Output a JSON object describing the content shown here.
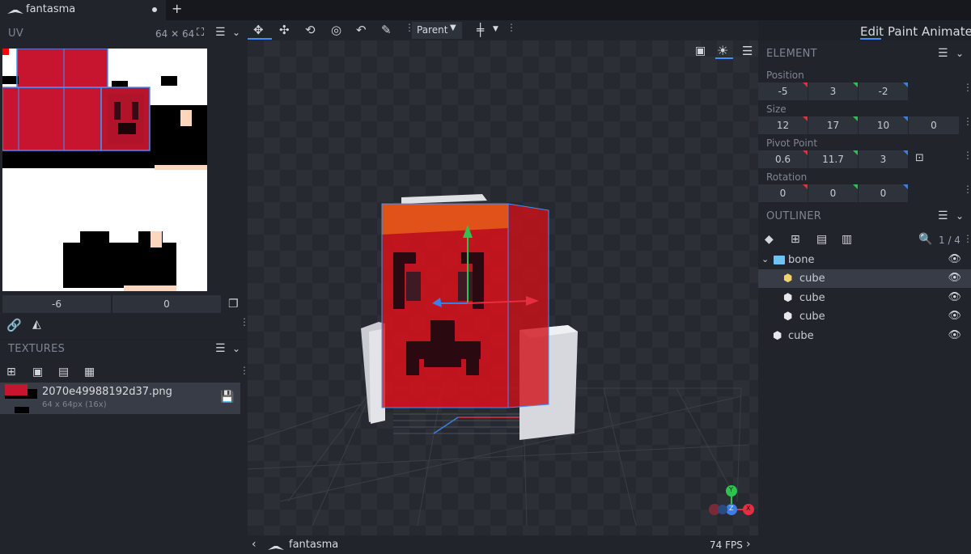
{
  "tab": {
    "title": "fantasma"
  },
  "uv": {
    "header": "UV",
    "size": "64 ✕ 64",
    "inputs": [
      "-6",
      "0"
    ]
  },
  "textures": {
    "header": "TEXTURES",
    "file_name": "2070e49988192d37.png",
    "file_info": "64 x 64px (16x)"
  },
  "toolbar": {
    "pivot_mode": "Parent",
    "modes": [
      "Edit",
      "Paint",
      "Animate"
    ],
    "active_mode": "Edit"
  },
  "element": {
    "header": "ELEMENT",
    "position": {
      "label": "Position",
      "values": [
        "-5",
        "3",
        "-2"
      ]
    },
    "size": {
      "label": "Size",
      "values": [
        "12",
        "17",
        "10",
        "0"
      ]
    },
    "pivot": {
      "label": "Pivot Point",
      "values": [
        "0.6",
        "11.7",
        "3"
      ]
    },
    "rotation": {
      "label": "Rotation",
      "values": [
        "0",
        "0",
        "0"
      ]
    }
  },
  "outliner": {
    "header": "OUTLINER",
    "count": "1 / 4",
    "items": [
      {
        "name": "bone",
        "type": "folder"
      },
      {
        "name": "cube",
        "type": "cube",
        "selected": true
      },
      {
        "name": "cube",
        "type": "cube"
      },
      {
        "name": "cube",
        "type": "cube"
      },
      {
        "name": "cube",
        "type": "cube"
      }
    ]
  },
  "status": {
    "project": "fantasma",
    "fps": "74 FPS"
  },
  "gizmo": {
    "y": "Y",
    "z": "Z",
    "x": "X"
  },
  "colors": {
    "accent": "#3e90ff",
    "x_axis": "#e52e42",
    "y_axis": "#2ec24f",
    "z_axis": "#3b7ee6"
  }
}
